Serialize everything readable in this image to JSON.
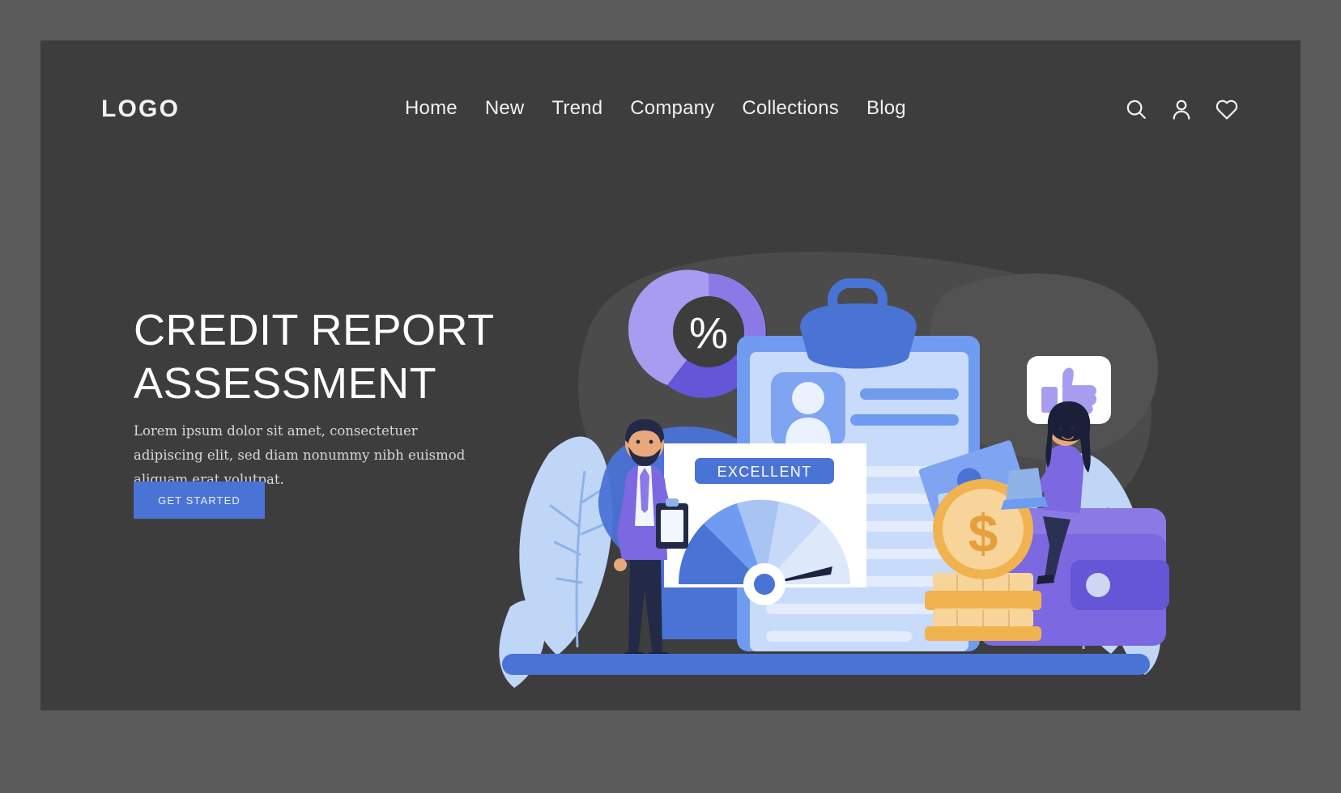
{
  "page": {
    "background_color": "#5b5b5b",
    "frame_color": "#3d3d3d"
  },
  "header": {
    "logo": "LOGO",
    "nav_items": [
      {
        "label": "Home"
      },
      {
        "label": "New"
      },
      {
        "label": "Trend"
      },
      {
        "label": "Company"
      },
      {
        "label": "Collections"
      },
      {
        "label": "Blog"
      }
    ],
    "icons": [
      {
        "name": "search-icon"
      },
      {
        "name": "user-icon"
      },
      {
        "name": "heart-icon"
      }
    ]
  },
  "hero": {
    "headline": "CREDIT REPORT ASSESSMENT",
    "subcopy": "Lorem ipsum dolor sit amet, consectetuer adipiscing elit, sed diam nonummy nibh euismod aliquam erat volutpat.",
    "cta_label": "GET STARTED"
  },
  "illustration": {
    "gauge_badge": "EXCELLENT",
    "percent_symbol": "%",
    "coin_symbol": "$",
    "colors": {
      "accent_blue": "#4a73d6",
      "light_blue": "#a8c4f2",
      "pale_blue": "#d5e3fb",
      "purple": "#7b63d4",
      "light_purple": "#a79df0",
      "gold": "#f0b350",
      "pale_gold": "#f7d49a",
      "white": "#ffffff",
      "dark_navy": "#2b3154"
    }
  }
}
